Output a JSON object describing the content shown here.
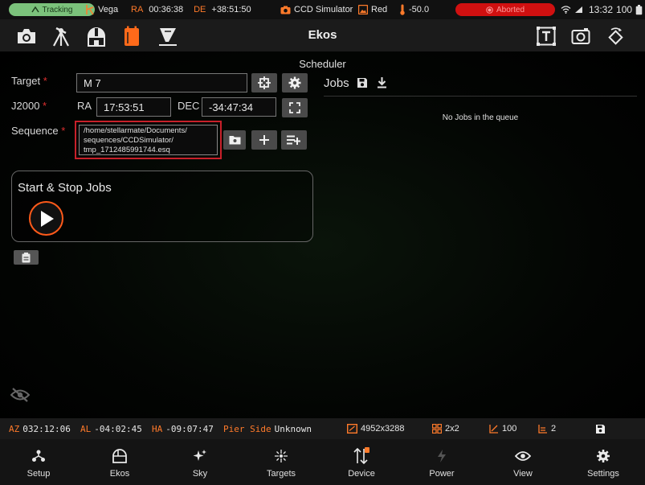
{
  "statusbar": {
    "tracking_label": "Tracking",
    "mount_name": "Vega",
    "ra_label": "RA",
    "ra_value": "00:36:38",
    "de_label": "DE",
    "de_value": "+38:51:50",
    "camera_name": "CCD Simulator",
    "filter_name": "Red",
    "temperature": "-50.0",
    "capture_status": "Aborted",
    "clock": "13:32",
    "battery": "100"
  },
  "toolbar": {
    "title": "Ekos",
    "left_icons": [
      "camera-icon",
      "mount-tripod-icon",
      "observatory-icon",
      "scheduler-icon",
      "telescope-icon"
    ],
    "right_icons": [
      "text-icon",
      "capture-frame-icon",
      "rotate-icon"
    ]
  },
  "scheduler": {
    "title": "Scheduler",
    "target_label": "Target",
    "target_value": "M 7",
    "j2000_label": "J2000",
    "ra_label": "RA",
    "ra_value": "17:53:51",
    "dec_label": "DEC",
    "dec_value": "-34:47:34",
    "sequence_label": "Sequence",
    "sequence_path": "/home/stellarmate/Documents/sequences/CCDSimulator/tmp_1712485991744.esq",
    "sequence_line1": "/home/stellarmate/Documents/",
    "sequence_line2": "sequences/CCDSimulator/",
    "sequence_line3": "tmp_1712485991744.esq",
    "required_mark": "*",
    "jobs_title": "Jobs",
    "no_jobs_text": "No Jobs in the queue",
    "start_stop_title": "Start & Stop Jobs"
  },
  "infobar": {
    "az_label": "AZ",
    "az_value": "032:12:06",
    "al_label": "AL",
    "al_value": "-04:02:45",
    "ha_label": "HA",
    "ha_value": "-09:07:47",
    "pier_label": "Pier Side",
    "pier_value": "Unknown",
    "resolution": "4952x3288",
    "binning": "2x2",
    "gain": "100",
    "offset": "2"
  },
  "bottomnav": {
    "items": [
      {
        "label": "Setup",
        "icon": "setup-icon"
      },
      {
        "label": "Ekos",
        "icon": "ekos-icon"
      },
      {
        "label": "Sky",
        "icon": "sky-icon"
      },
      {
        "label": "Targets",
        "icon": "targets-icon"
      },
      {
        "label": "Device",
        "icon": "device-icon"
      },
      {
        "label": "Power",
        "icon": "power-icon"
      },
      {
        "label": "View",
        "icon": "view-icon"
      },
      {
        "label": "Settings",
        "icon": "settings-icon"
      }
    ]
  },
  "colors": {
    "accent_orange": "#ff7a2a",
    "tracking_green": "#7bc27b",
    "aborted_red": "#d01010",
    "highlight_red": "#c8202a"
  }
}
